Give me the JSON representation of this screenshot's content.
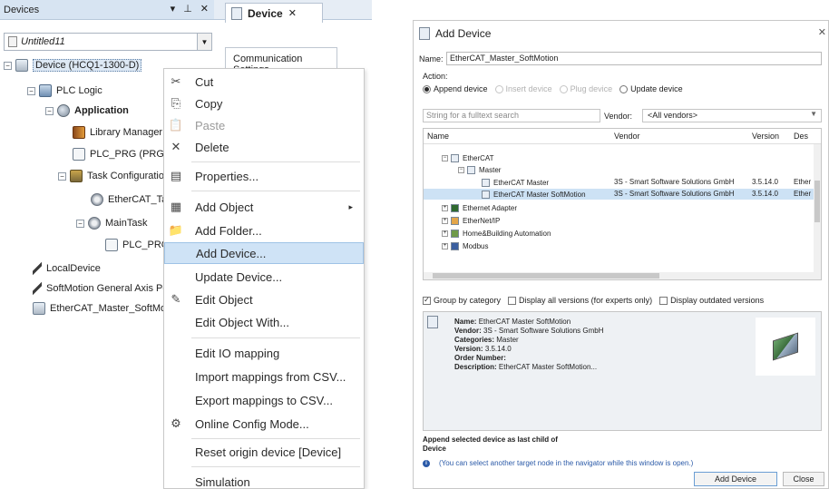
{
  "devices_panel": {
    "title": "Devices",
    "controls": [
      "▾",
      "⊥",
      "✕"
    ],
    "project_combo": "Untitled11",
    "tree": {
      "device": "Device (HCQ1-1300-D)",
      "plc_logic": "PLC Logic",
      "application": "Application",
      "library_manager": "Library Manager",
      "plc_prg_program": "PLC_PRG (PRG)",
      "task_configuration": "Task Configuration",
      "ethercat_task": "EtherCAT_Task",
      "main_task": "MainTask",
      "plc_prg": "PLC_PRG",
      "local_device": "LocalDevice",
      "softmotion_pool": "SoftMotion General Axis Poo",
      "ethercat_master": "EtherCAT_Master_SoftMotic"
    }
  },
  "editor": {
    "tab_label": "Device",
    "tab_close": "✕",
    "comm_settings": "Communication Settings"
  },
  "context_menu": {
    "items": [
      {
        "label": "Cut",
        "icon": "✂"
      },
      {
        "label": "Copy",
        "icon": "⎘"
      },
      {
        "label": "Paste",
        "icon": "📋"
      },
      {
        "label": "Delete",
        "icon": "✕"
      },
      {
        "label": "Properties...",
        "icon": "▤"
      },
      {
        "label": "Add Object",
        "icon": "▦",
        "submenu_arrow": "▸"
      },
      {
        "label": "Add Folder...",
        "icon": "📁"
      },
      {
        "label": "Add Device...",
        "icon": ""
      },
      {
        "label": "Update Device...",
        "icon": ""
      },
      {
        "label": "Edit Object",
        "icon": "✎"
      },
      {
        "label": "Edit Object With...",
        "icon": ""
      },
      {
        "label": "Edit IO mapping",
        "icon": ""
      },
      {
        "label": "Import mappings from CSV...",
        "icon": ""
      },
      {
        "label": "Export mappings to CSV...",
        "icon": ""
      },
      {
        "label": "Online Config Mode...",
        "icon": "⚙"
      },
      {
        "label": "Reset origin device [Device]",
        "icon": ""
      },
      {
        "label": "Simulation",
        "icon": ""
      }
    ],
    "highlighted": "Add Device..."
  },
  "dialog": {
    "title": "Add Device",
    "close": "✕",
    "name_label": "Name:",
    "name_value": "EtherCAT_Master_SoftMotion",
    "action_label": "Action:",
    "actions": [
      "Append device",
      "Insert device",
      "Plug device",
      "Update device"
    ],
    "search_placeholder": "String for a fulltext search",
    "vendor_label": "Vendor:",
    "vendor_value": "<All vendors>",
    "columns": [
      "Name",
      "Vendor",
      "Version",
      "Des"
    ],
    "rows": [
      {
        "name": "EtherCAT",
        "vendor": "",
        "version": "",
        "desc": ""
      },
      {
        "name": "Master",
        "vendor": "",
        "version": "",
        "desc": ""
      },
      {
        "name": "EtherCAT Master",
        "vendor": "3S - Smart Software Solutions GmbH",
        "version": "3.5.14.0",
        "desc": "Ether"
      },
      {
        "name": "EtherCAT Master SoftMotion",
        "vendor": "3S - Smart Software Solutions GmbH",
        "version": "3.5.14.0",
        "desc": "Ether"
      },
      {
        "name": "Ethernet Adapter",
        "vendor": "",
        "version": "",
        "desc": ""
      },
      {
        "name": "EtherNet/IP",
        "vendor": "",
        "version": "",
        "desc": ""
      },
      {
        "name": "Home&Building Automation",
        "vendor": "",
        "version": "",
        "desc": ""
      },
      {
        "name": "Modbus",
        "vendor": "",
        "version": "",
        "desc": ""
      }
    ],
    "checkboxes": [
      {
        "label": "Group by category",
        "checked": true
      },
      {
        "label": "Display all versions (for experts only)",
        "checked": false
      },
      {
        "label": "Display outdated versions",
        "checked": false
      }
    ],
    "info": {
      "name_key": "Name:",
      "name_val": "EtherCAT Master SoftMotion",
      "vendor_key": "Vendor:",
      "vendor_val": "3S - Smart Software Solutions GmbH",
      "categories_key": "Categories:",
      "categories_val": "Master",
      "version_key": "Version:",
      "version_val": "3.5.14.0",
      "order_key": "Order Number:",
      "order_val": "",
      "desc_key": "Description:",
      "desc_val": "EtherCAT Master SoftMotion..."
    },
    "append_line1": "Append selected device as last child of",
    "append_line2": "Device",
    "hint": "(You can select another target node in the navigator while this window is open.)",
    "add_button": "Add Device",
    "close_button": "Close"
  }
}
